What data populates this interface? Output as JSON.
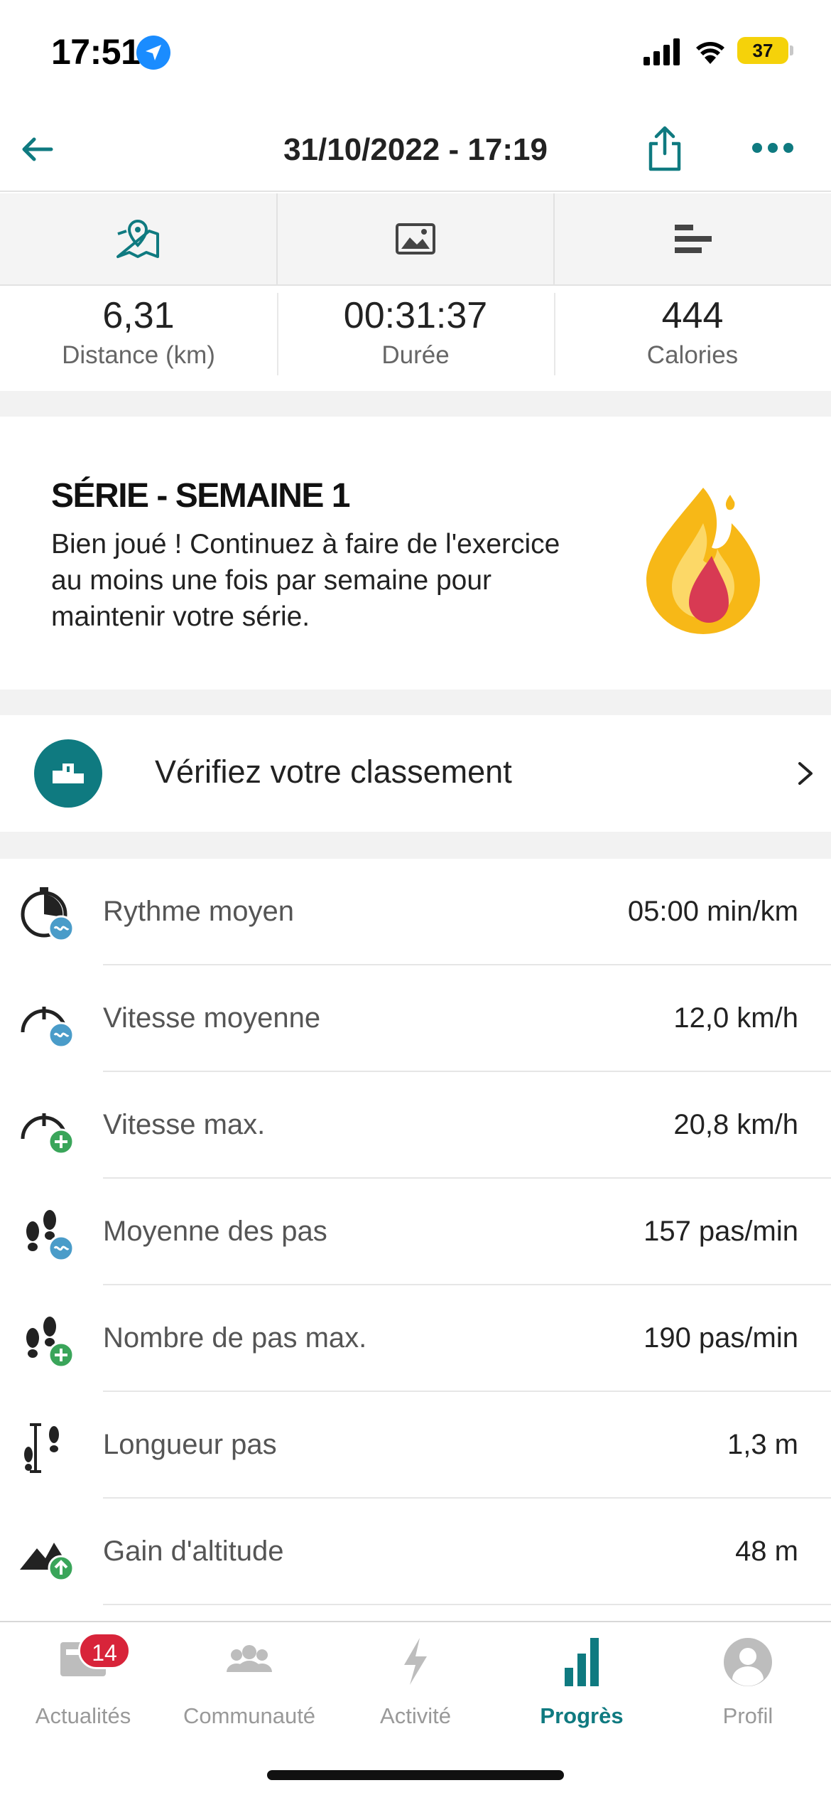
{
  "status_bar": {
    "time": "17:51",
    "battery": "37"
  },
  "header": {
    "title": "31/10/2022 - 17:19"
  },
  "tabs": [
    {
      "icon": "map-icon"
    },
    {
      "icon": "image-icon"
    },
    {
      "icon": "bars-icon"
    }
  ],
  "summary": [
    {
      "value": "6,31",
      "label": "Distance (km)"
    },
    {
      "value": "00:31:37",
      "label": "Durée"
    },
    {
      "value": "444",
      "label": "Calories"
    }
  ],
  "streak": {
    "title": "SÉRIE - SEMAINE 1",
    "text": "Bien joué ! Continuez à faire de l'exercice au moins une fois par semaine pour maintenir votre série."
  },
  "ranking": {
    "label": "Vérifiez votre classement"
  },
  "metrics": [
    {
      "icon": "pace-average-icon",
      "label": "Rythme moyen",
      "value": "05:00 min/km"
    },
    {
      "icon": "speed-average-icon",
      "label": "Vitesse moyenne",
      "value": "12,0 km/h"
    },
    {
      "icon": "speed-max-icon",
      "label": "Vitesse max.",
      "value": "20,8 km/h"
    },
    {
      "icon": "steps-average-icon",
      "label": "Moyenne des pas",
      "value": "157 pas/min"
    },
    {
      "icon": "steps-max-icon",
      "label": "Nombre de pas max.",
      "value": "190 pas/min"
    },
    {
      "icon": "stride-length-icon",
      "label": "Longueur pas",
      "value": "1,3 m"
    },
    {
      "icon": "elevation-gain-icon",
      "label": "Gain d'altitude",
      "value": "48 m"
    }
  ],
  "nav": {
    "items": [
      {
        "label": "Actualités",
        "badge": "14"
      },
      {
        "label": "Communauté"
      },
      {
        "label": "Activité"
      },
      {
        "label": "Progrès"
      },
      {
        "label": "Profil"
      }
    ],
    "active_color": "#0f7a80",
    "inactive_color": "#999999"
  },
  "colors": {
    "accent": "#0f7a80",
    "badge": "#d8243a",
    "overlay_blue": "#4a9cc9",
    "overlay_green": "#3aa55a"
  }
}
